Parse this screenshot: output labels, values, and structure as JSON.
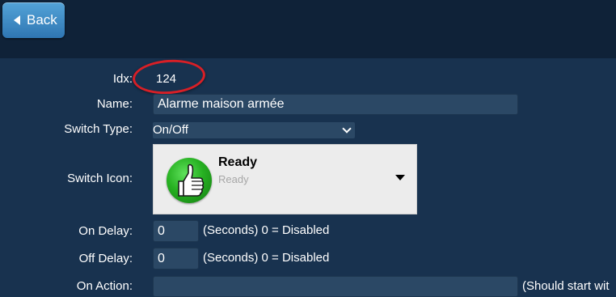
{
  "header": {
    "back_label": "Back"
  },
  "form": {
    "idx_label": "Idx:",
    "idx_value": "124",
    "name_label": "Name:",
    "name_value": "Alarme maison armée",
    "switch_type_label": "Switch Type:",
    "switch_type_value": "On/Off",
    "switch_icon_label": "Switch Icon:",
    "switch_icon_title": "Ready",
    "switch_icon_subtitle": "Ready",
    "switch_icon_name": "thumbs-up-icon",
    "on_delay_label": "On Delay:",
    "on_delay_value": "0",
    "on_delay_hint": "(Seconds) 0 = Disabled",
    "off_delay_label": "Off Delay:",
    "off_delay_value": "0",
    "off_delay_hint": "(Seconds) 0 = Disabled",
    "on_action_label": "On Action:",
    "on_action_value": "",
    "on_action_hint": "(Should start wit"
  },
  "colors": {
    "background": "#18324f",
    "topbar": "#0f2238",
    "accent_button": "#3f8dc8",
    "highlight_ring": "#d81f26",
    "icon_green": "#27b122"
  }
}
